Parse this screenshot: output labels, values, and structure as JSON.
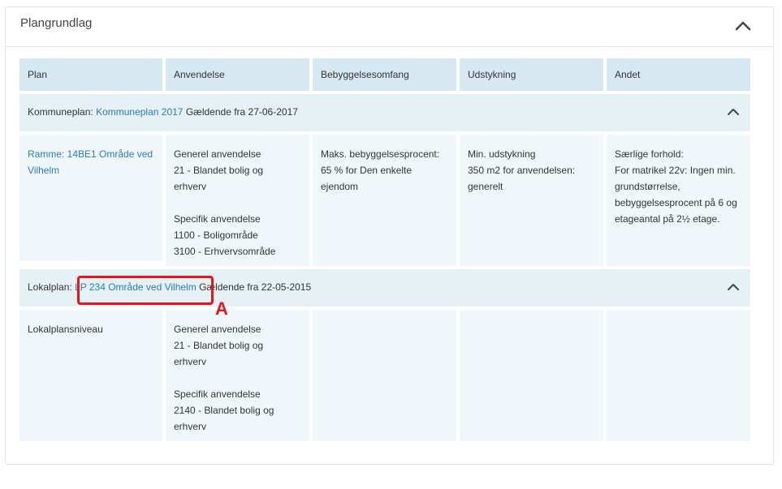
{
  "panel": {
    "title": "Plangrundlag"
  },
  "table": {
    "headers": [
      "Plan",
      "Anvendelse",
      "Bebyggelsesomfang",
      "Udstykning",
      "Andet"
    ],
    "kommuneplan": {
      "prefix": "Kommuneplan:",
      "link": "Kommuneplan 2017",
      "suffix": "Gældende fra 27-06-2017",
      "ramme_link": [
        "Ramme: 14BE1 Område ved",
        "Vilhelm"
      ],
      "anvendelse": [
        "Generel anvendelse",
        "21 - Blandet bolig og",
        "erhverv",
        "Specifik anvendelse",
        "1100 - Boligområde",
        "3100 - Erhvervsområde"
      ],
      "bebyggelse": [
        "Maks. bebyggelsesprocent:",
        "65 % for Den enkelte",
        "ejendom"
      ],
      "udstykning": [
        "Min. udstykning",
        "350 m2 for anvendelsen:",
        "generelt"
      ],
      "andet": [
        "Særlige forhold:",
        "For matrikel 22v: Ingen min.",
        "grundstørrelse,",
        "bebyggelsesprocent på 6 og",
        "etageantal på 2½ etage."
      ]
    },
    "lokalplan": {
      "prefix": "Lokalplan:",
      "link": "LP 234 Område ved Vilhelm",
      "suffix": "Gældende fra 22-05-2015",
      "niveau": "Lokalplansniveau",
      "anvendelse": [
        "Generel anvendelse",
        "21 - Blandet bolig og",
        "erhverv",
        "Specifik anvendelse",
        "2140 - Blandet bolig og",
        "erhverv"
      ]
    }
  },
  "annotation": {
    "label": "A",
    "color": "#e8141b"
  },
  "colors": {
    "header_bg": "#d6e9f2",
    "section_bg": "#e6f1f6",
    "cell_bg": "#f0f7fa",
    "link": "#2a7bb3"
  },
  "icons": {
    "collapse": "chevron-up-icon"
  }
}
